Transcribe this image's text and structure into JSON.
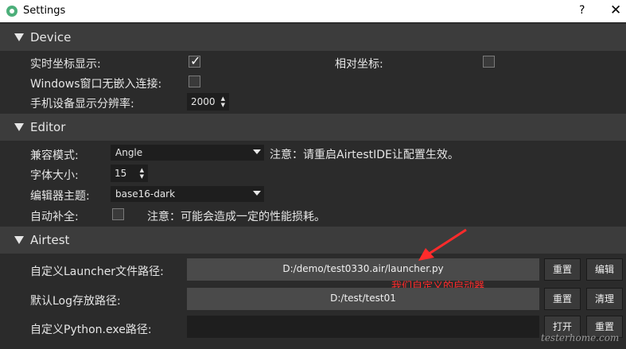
{
  "window": {
    "title": "Settings",
    "help": "?",
    "close": "✕"
  },
  "device": {
    "section_title": "Device",
    "realtime_coords_label": "实时坐标显示:",
    "realtime_coords_checked": true,
    "relative_coords_label": "相对坐标:",
    "relative_coords_checked": false,
    "windows_embed_label": "Windows窗口无嵌入连接:",
    "windows_embed_checked": false,
    "resolution_label": "手机设备显示分辨率:",
    "resolution_value": "2000"
  },
  "editor": {
    "section_title": "Editor",
    "compat_label": "兼容模式:",
    "compat_value": "Angle",
    "compat_note": "注意：请重启AirtestIDE让配置生效。",
    "fontsize_label": "字体大小:",
    "fontsize_value": "15",
    "theme_label": "编辑器主题:",
    "theme_value": "base16-dark",
    "autocomplete_label": "自动补全:",
    "autocomplete_checked": false,
    "autocomplete_note": "注意：可能会造成一定的性能损耗。"
  },
  "airtest": {
    "section_title": "Airtest",
    "launcher_label": "自定义Launcher文件路径:",
    "launcher_value": "D:/demo/test0330.air/launcher.py",
    "launcher_reset": "重置",
    "launcher_edit": "编辑",
    "annotation": "我们自定义的启动器",
    "log_label": "默认Log存放路径:",
    "log_value": "D:/test/test01",
    "log_reset": "重置",
    "log_clear": "清理",
    "python_label": "自定义Python.exe路径:",
    "python_value": "",
    "python_open": "打开",
    "python_reset": "重置"
  },
  "watermark": "testerhome.com",
  "colors": {
    "annotation": "#ff2b2b",
    "background": "#2b2b2b",
    "section": "#3c3c3c"
  }
}
